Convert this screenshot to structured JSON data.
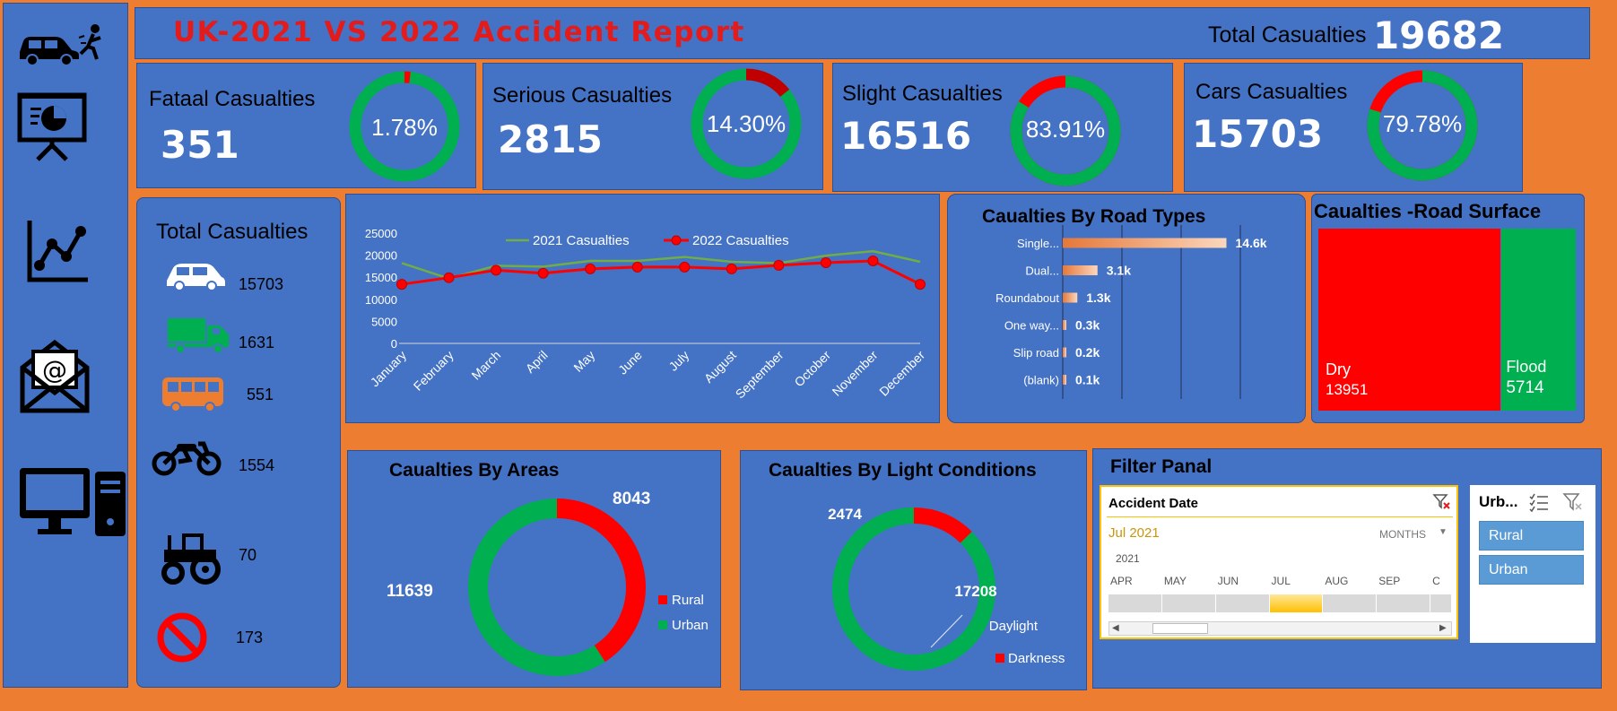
{
  "header": {
    "title": "UK-2021 VS 2022 Accident Report",
    "total_label": "Total Casualties",
    "total_value": "19682"
  },
  "sidebar": {
    "icons": [
      "car-crash-icon",
      "presentation-chart-icon",
      "line-chart-icon",
      "email-icon",
      "computer-icon"
    ]
  },
  "kpis": [
    {
      "label": "Fataal Casualties",
      "value": "351",
      "pct_label": "1.78%",
      "pct": 1.78
    },
    {
      "label": "Serious Casualties",
      "value": "2815",
      "pct_label": "14.30%",
      "pct": 14.3
    },
    {
      "label": "Slight Casualties",
      "value": "16516",
      "pct_label": "83.91%",
      "pct": 83.91
    },
    {
      "label": "Cars Casualties",
      "value": "15703",
      "pct_label": "79.78%",
      "pct": 79.78
    }
  ],
  "vehicles": {
    "title": "Total Casualties",
    "items": [
      {
        "icon": "car-icon",
        "value": "15703"
      },
      {
        "icon": "truck-icon",
        "value": "1631"
      },
      {
        "icon": "bus-icon",
        "value": "551"
      },
      {
        "icon": "motorcycle-icon",
        "value": "1554"
      },
      {
        "icon": "tractor-icon",
        "value": "70"
      },
      {
        "icon": "no-entry-icon",
        "value": "173"
      }
    ]
  },
  "colors": {
    "background": "#ed7d31",
    "panel": "#4472c4",
    "green": "#00b050",
    "red": "#ff0000",
    "title_red": "#e31b1b",
    "line_2021": "#70ad47",
    "bar_orange": "#f4b183"
  },
  "chart_data": [
    {
      "type": "line",
      "categories": [
        "January",
        "February",
        "March",
        "April",
        "May",
        "June",
        "July",
        "August",
        "September",
        "October",
        "November",
        "December"
      ],
      "series": [
        {
          "name": "2021 Casualties",
          "values": [
            18200,
            14700,
            17600,
            17400,
            18700,
            18700,
            19600,
            18500,
            18200,
            19900,
            20900,
            18500
          ]
        },
        {
          "name": "2022 Casualties",
          "values": [
            13400,
            14900,
            16600,
            15900,
            16900,
            17300,
            17300,
            16900,
            17700,
            18300,
            18700,
            13400
          ]
        }
      ],
      "yticks": [
        "0",
        "5000",
        "10000",
        "15000",
        "20000",
        "25000"
      ],
      "ylim": [
        0,
        25000
      ],
      "legend": "top"
    },
    {
      "type": "bar",
      "title": "Caualties By Road Types",
      "categories": [
        "Single...",
        "Dual...",
        "Roundabout",
        "One way...",
        "Slip road",
        "(blank)"
      ],
      "values": [
        14600,
        3100,
        1300,
        300,
        200,
        100
      ],
      "labels": [
        "14.6k",
        "3.1k",
        "1.3k",
        "0.3k",
        "0.2k",
        "0.1k"
      ],
      "xlim": [
        0,
        20000
      ]
    },
    {
      "type": "heatmap",
      "title": "Caualties -Road Surface",
      "items": [
        {
          "label": "Dry",
          "value": 13951
        },
        {
          "label": "Flood",
          "value": 5714
        }
      ]
    },
    {
      "type": "pie",
      "title": "Caualties By Areas",
      "slices": [
        {
          "name": "Rural",
          "value": 8043,
          "label": "8043"
        },
        {
          "name": "Urban",
          "value": 11639,
          "label": "11639"
        }
      ],
      "legend": "right"
    },
    {
      "type": "pie",
      "title": "Caualties By Light Conditions",
      "slices": [
        {
          "name": "Darkness",
          "value": 2474,
          "label": "2474"
        },
        {
          "name": "Daylight",
          "value": 17208,
          "label": "17208"
        }
      ],
      "legend": "right"
    }
  ],
  "filter": {
    "title": "Filter Panal",
    "timeline": {
      "header": "Accident Date",
      "selected": "Jul 2021",
      "unit": "MONTHS",
      "year": "2021",
      "months": [
        "APR",
        "MAY",
        "JUN",
        "JUL",
        "AUG",
        "SEP",
        "C"
      ],
      "selected_index": 3
    },
    "slicer": {
      "header": "Urb...",
      "items": [
        "Rural",
        "Urban"
      ]
    }
  }
}
